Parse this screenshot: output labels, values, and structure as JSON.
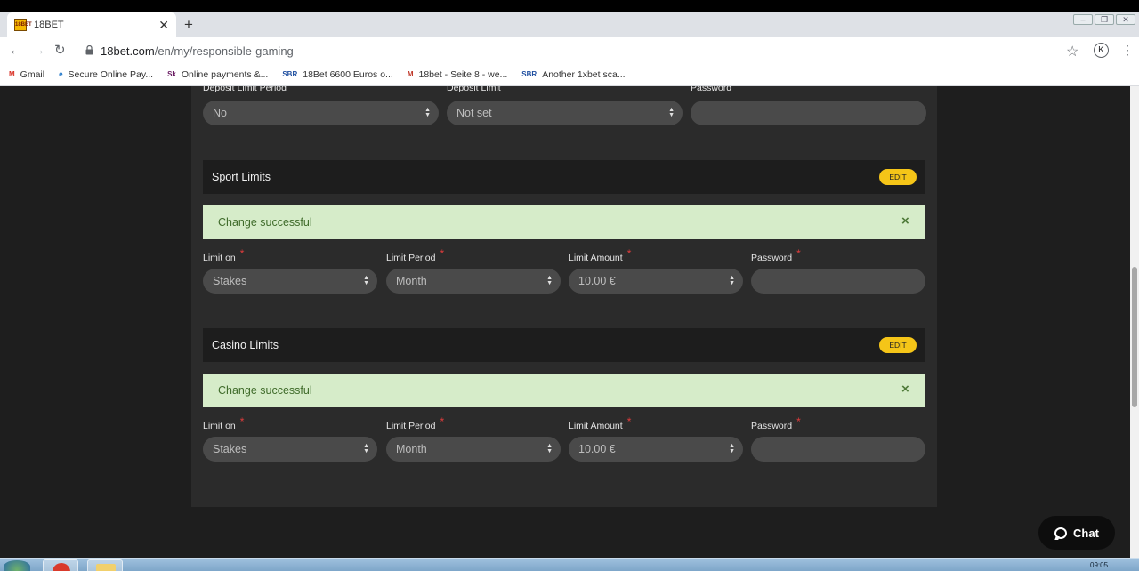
{
  "browser": {
    "tab_title": "18BET",
    "favicon_text": "18BET",
    "url_host": "18bet.com",
    "url_path": "/en/my/responsible-gaming",
    "profile_initial": "K",
    "bookmarks": [
      {
        "label": "Gmail",
        "icon": "gmail-icon",
        "icon_text": "M",
        "color": "#d93025"
      },
      {
        "label": "Secure Online Pay...",
        "icon": "ie-icon",
        "icon_text": "e",
        "color": "#1a73c8"
      },
      {
        "label": "Online payments &...",
        "icon": "skrill-icon",
        "icon_text": "Sk",
        "color": "#6b1d64"
      },
      {
        "label": "18Bet 6600 Euros o...",
        "icon": "sbr-icon",
        "icon_text": "SBR",
        "color": "#1f4fa0"
      },
      {
        "label": "18bet - Seite:8 - we...",
        "icon": "forum-icon",
        "icon_text": "M",
        "color": "#c0392b"
      },
      {
        "label": "Another 1xbet sca...",
        "icon": "sbr-icon",
        "icon_text": "SBR",
        "color": "#1f4fa0"
      }
    ]
  },
  "deposit": {
    "period_label": "Deposit Limit Period",
    "period_value": "No",
    "limit_label": "Deposit Limit",
    "limit_value": "Not set",
    "password_label": "Password"
  },
  "sport": {
    "title": "Sport Limits",
    "edit_label": "EDIT",
    "alert": "Change successful",
    "close_symbol": "×",
    "limit_on_label": "Limit on",
    "limit_on_value": "Stakes",
    "period_label": "Limit Period",
    "period_value": "Month",
    "amount_label": "Limit Amount",
    "amount_value": "10.00 €",
    "password_label": "Password",
    "required_mark": "*"
  },
  "casino": {
    "title": "Casino Limits",
    "edit_label": "EDIT",
    "alert": "Change successful",
    "close_symbol": "×",
    "limit_on_label": "Limit on",
    "limit_on_value": "Stakes",
    "period_label": "Limit Period",
    "period_value": "Month",
    "amount_label": "Limit Amount",
    "amount_value": "10.00 €",
    "password_label": "Password",
    "required_mark": "*"
  },
  "chat_label": "Chat",
  "taskbar": {
    "time": "09:05"
  },
  "colors": {
    "accent": "#f5c518",
    "success_bg": "#d6ecc9",
    "required": "#e03c3c",
    "panel": "#2b2b2b"
  }
}
